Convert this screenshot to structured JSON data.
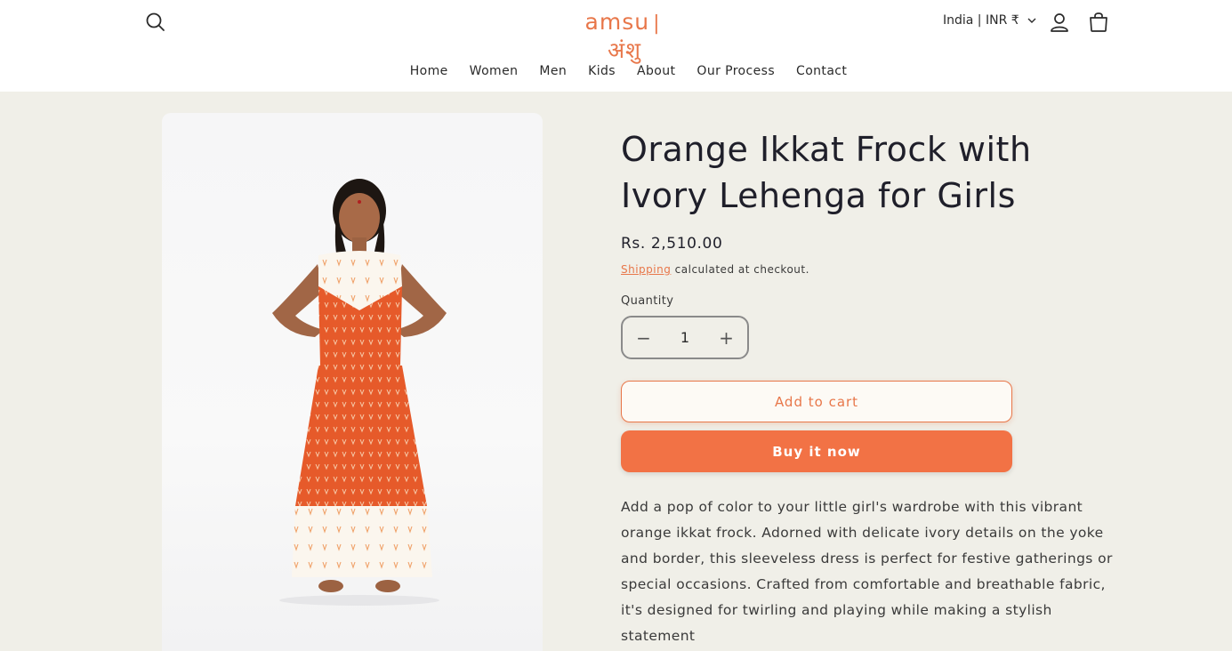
{
  "header": {
    "logo_text": "amsu",
    "logo_separator": "|",
    "logo_devanagari": "अंशु",
    "country_label": "India | INR ₹"
  },
  "nav": {
    "items": [
      "Home",
      "Women",
      "Men",
      "Kids",
      "About",
      "Our Process",
      "Contact"
    ]
  },
  "product": {
    "title": "Orange Ikkat Frock with Ivory Lehenga for Girls",
    "price": "Rs. 2,510.00",
    "shipping_link": "Shipping",
    "shipping_suffix": " calculated at checkout.",
    "quantity_label": "Quantity",
    "quantity_value": "1",
    "decrease_symbol": "−",
    "increase_symbol": "+",
    "add_to_cart_label": "Add to cart",
    "buy_now_label": "Buy it now",
    "description": "Add a pop of color to your little girl's wardrobe with this vibrant orange ikkat frock. Adorned with delicate ivory details on the yoke and border, this sleeveless dress is perfect for festive gatherings or special occasions. Crafted from comfortable and breathable fabric, it's designed for twirling and playing while making a stylish statement"
  },
  "colors": {
    "accent": "#e8774a",
    "buy_button": "#f27245",
    "page_background": "#f0efe8",
    "header_background": "#ffffff"
  },
  "icons": [
    "search-icon",
    "chevron-down-icon",
    "account-icon",
    "cart-icon",
    "minus-icon",
    "plus-icon"
  ]
}
